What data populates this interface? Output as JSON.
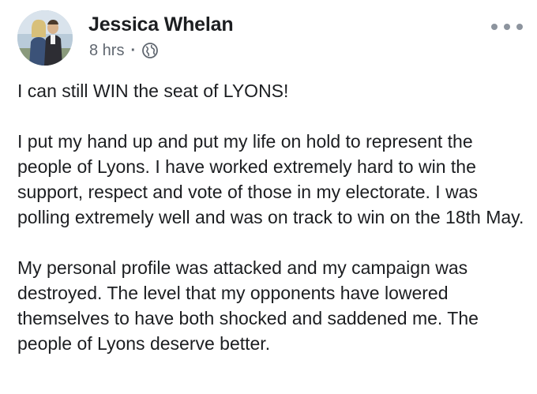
{
  "post": {
    "author": "Jessica Whelan",
    "timestamp": "8 hrs",
    "separator": "·",
    "audience_icon": "globe-icon",
    "menu_icon": "more-options-icon",
    "paragraphs": [
      "I can still WIN the seat of LYONS!",
      "I put my hand up and put my life on hold to represent the people of Lyons. I have worked extremely hard to win the support, respect and vote of those in my electorate. I was polling extremely well and was on track to win on the 18th May.",
      "My personal profile was attacked and my campaign was destroyed. The level that my opponents have lowered themselves to have both shocked and saddened me. The people of Lyons deserve better."
    ]
  },
  "colors": {
    "text_primary": "#1c1e21",
    "text_secondary": "#606770",
    "icon_gray": "#8d949e"
  }
}
